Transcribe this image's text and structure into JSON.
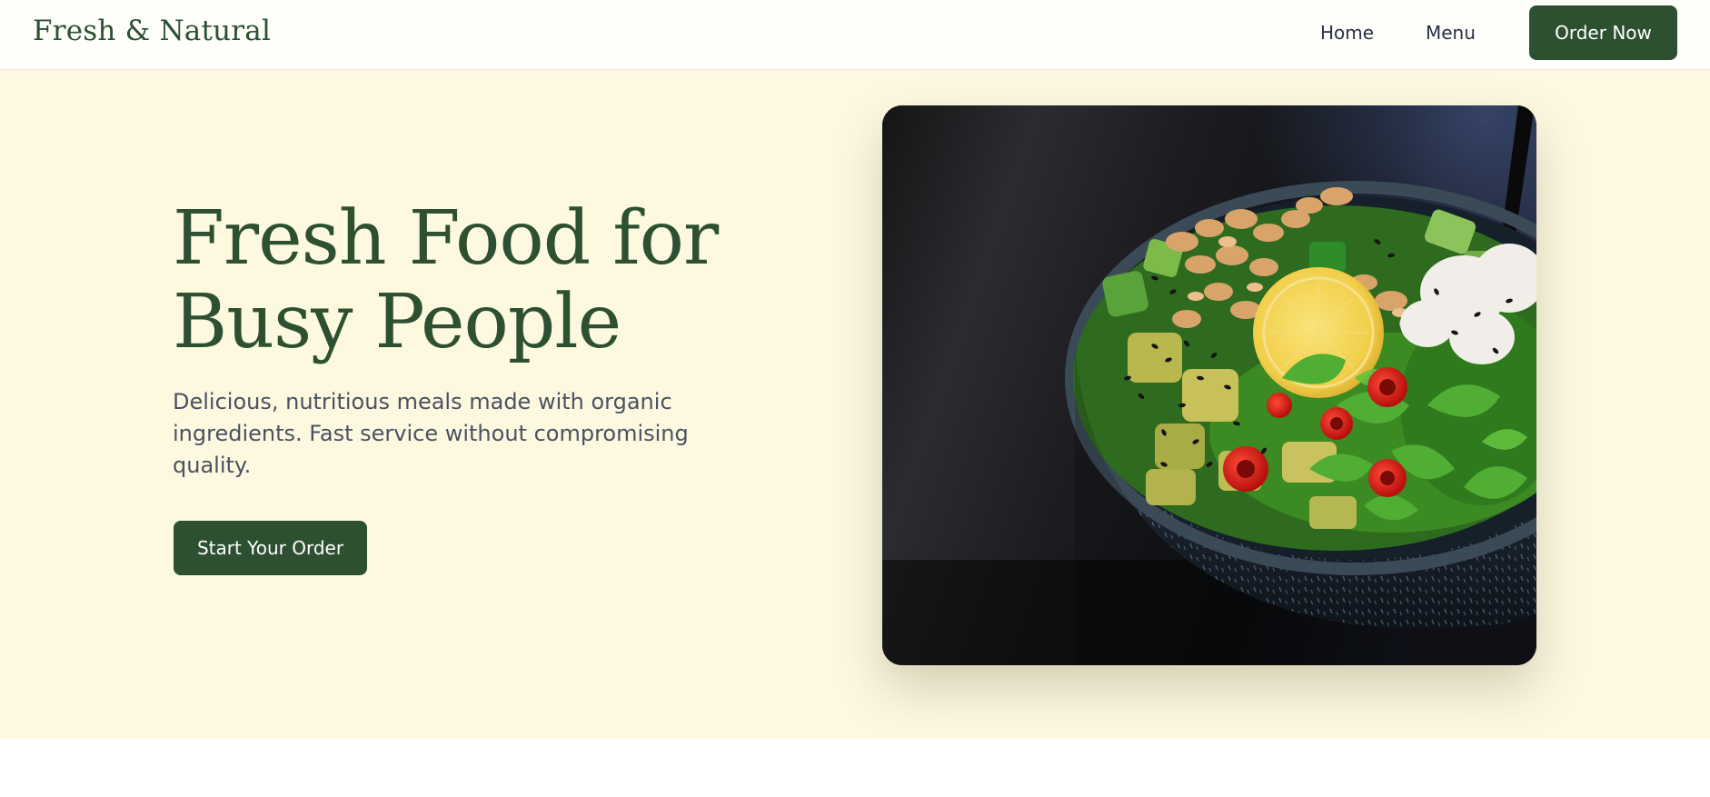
{
  "header": {
    "brand": "Fresh & Natural",
    "nav": [
      {
        "label": "Home"
      },
      {
        "label": "Menu"
      }
    ],
    "cta_label": "Order Now"
  },
  "hero": {
    "title": "Fresh Food for Busy People",
    "subtitle": "Delicious, nutritious meals made with organic ingredients. Fast service without compromising quality.",
    "cta_label": "Start Your Order",
    "image": {
      "subject": "salad bowl"
    }
  },
  "colors": {
    "brand_green": "#2d5031",
    "hero_background": "#fdf8e0",
    "nav_background": "#fefefb",
    "body_text": "#4b5260"
  }
}
